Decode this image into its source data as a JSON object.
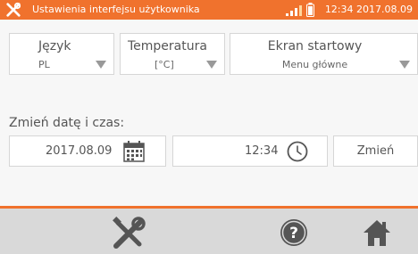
{
  "header": {
    "title": "Ustawienia interfejsu użytkownika",
    "clock": "12:34 2017.08.09",
    "icons": [
      "tools-icon",
      "signal-icon",
      "battery-icon"
    ]
  },
  "settings": {
    "language": {
      "label": "Język",
      "value": "PL"
    },
    "temperature": {
      "label": "Temperatura",
      "value": "[°C]"
    },
    "start_screen": {
      "label": "Ekran startowy",
      "value": "Menu główne"
    }
  },
  "datetime": {
    "section_label": "Zmień datę i czas:",
    "date": "2017.08.09",
    "time": "12:34",
    "change_button": "Zmień"
  },
  "toolbar": {
    "icons": [
      "tools-icon",
      "help-icon",
      "home-icon"
    ]
  },
  "colors": {
    "accent": "#f0722d",
    "toolbar_bg": "#d9d9d9",
    "icon": "#555555"
  }
}
